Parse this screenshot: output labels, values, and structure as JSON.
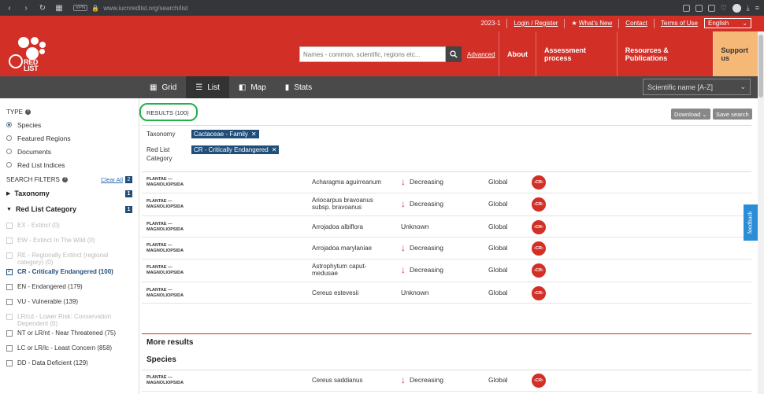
{
  "browser": {
    "url": "www.iucnredlist.org/search/list",
    "vpn_label": "VPN"
  },
  "topbar": {
    "version": "2023-1",
    "login": "Login / Register",
    "whats_new": "What's New",
    "contact": "Contact",
    "terms": "Terms of Use",
    "language": "English"
  },
  "header": {
    "logo_text_1": "RED",
    "logo_text_2": "LIST",
    "search_placeholder": "Names - common, scientific, regions etc...",
    "advanced": "Advanced",
    "nav": [
      "About",
      "Assessment process",
      "Resources & Publications",
      "Support us"
    ]
  },
  "toolbar": {
    "tabs": [
      "Grid",
      "List",
      "Map",
      "Stats"
    ],
    "active_tab": "List",
    "sort": "Scientific name [A-Z]"
  },
  "sidebar": {
    "type_label": "TYPE",
    "types": [
      "Species",
      "Featured Regions",
      "Documents",
      "Red List Indices"
    ],
    "selected_type": "Species",
    "search_filters": "SEARCH FILTERS",
    "clear_all": "Clear All",
    "filter_count": "2",
    "taxonomy": "Taxonomy",
    "taxonomy_count": "1",
    "rlc": "Red List Category",
    "rlc_count": "1",
    "categories": [
      {
        "label": "EX - Extinct (0)",
        "state": "disabled"
      },
      {
        "label": "EW - Extinct In The Wild (0)",
        "state": "disabled"
      },
      {
        "label": "RE - Regionally Extinct (regional category) (0)",
        "state": "disabled"
      },
      {
        "label": "CR - Critically Endangered (100)",
        "state": "checked"
      },
      {
        "label": "EN - Endangered (179)",
        "state": "normal"
      },
      {
        "label": "VU - Vulnerable (139)",
        "state": "normal"
      },
      {
        "label": "LR/cd - Lower Risk: Conservation Dependent (0)",
        "state": "disabled"
      },
      {
        "label": "NT or LR/nt - Near Threatened (75)",
        "state": "normal"
      },
      {
        "label": "LC or LR/lc - Least Concern (858)",
        "state": "normal"
      },
      {
        "label": "DD - Data Deficient (129)",
        "state": "normal"
      }
    ]
  },
  "main": {
    "results": "RESULTS (100)",
    "download": "Download",
    "save_search": "Save search",
    "taxonomy_label": "Taxonomy",
    "taxonomy_chip": "Cactaceae - Family",
    "rlc_label_1": "Red List",
    "rlc_label_2": "Category",
    "rlc_chip": "CR - Critically Endangered",
    "rows": [
      {
        "kp1": "PLANTAE —",
        "kp2": "MAGNOLIOPSIDA",
        "name": "Acharagma aguirreanum",
        "trend": "Decreasing",
        "scope": "Global",
        "cat": "CR"
      },
      {
        "kp1": "PLANTAE —",
        "kp2": "MAGNOLIOPSIDA",
        "name": "Ariocarpus bravoanus subsp. bravoanus",
        "trend": "Decreasing",
        "scope": "Global",
        "cat": "CR"
      },
      {
        "kp1": "PLANTAE —",
        "kp2": "MAGNOLIOPSIDA",
        "name": "Arrojadoa albiflora",
        "trend": "Unknown",
        "scope": "Global",
        "cat": "CR"
      },
      {
        "kp1": "PLANTAE —",
        "kp2": "MAGNOLIOPSIDA",
        "name": "Arrojadoa marylaniae",
        "trend": "Decreasing",
        "scope": "Global",
        "cat": "CR"
      },
      {
        "kp1": "PLANTAE —",
        "kp2": "MAGNOLIOPSIDA",
        "name": "Astrophytum caput-medusae",
        "trend": "Decreasing",
        "scope": "Global",
        "cat": "CR"
      },
      {
        "kp1": "PLANTAE —",
        "kp2": "MAGNOLIOPSIDA",
        "name": "Cereus estevesii",
        "trend": "Unknown",
        "scope": "Global",
        "cat": "CR"
      }
    ],
    "more_results": "More results",
    "species_head": "Species",
    "more_rows": [
      {
        "kp1": "PLANTAE —",
        "kp2": "MAGNOLIOPSIDA",
        "name": "Cereus saddianus",
        "trend": "Decreasing",
        "scope": "Global",
        "cat": "CR"
      }
    ]
  },
  "feedback": "feedback",
  "colors": {
    "brand_red": "#d22f27",
    "toolbar_gray": "#4a4a4a",
    "chip_blue": "#1f4e79",
    "support_orange": "#f5b876",
    "highlight_green": "#22b14c"
  }
}
